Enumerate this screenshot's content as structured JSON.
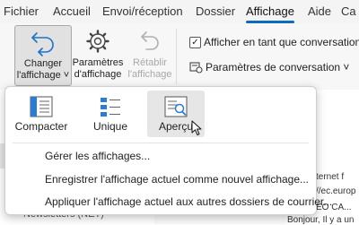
{
  "menubar": {
    "items": [
      {
        "label": "Fichier"
      },
      {
        "label": "Accueil"
      },
      {
        "label": "Envoi/réception"
      },
      {
        "label": "Dossier"
      },
      {
        "label": "Affichage",
        "active": true
      },
      {
        "label": "Aide"
      },
      {
        "label": "Ca"
      }
    ]
  },
  "ribbon": {
    "change_view": {
      "label": "Changer\nl'affichage ˅",
      "icon": "change-view-icon"
    },
    "view_settings": {
      "label": "Paramètres\nd'affichage",
      "icon": "gear-icon"
    },
    "reset_view": {
      "label": "Rétablir\nl'affichage",
      "icon": "reset-arrow-icon",
      "disabled": true
    },
    "show_as_conversations": {
      "label": "Afficher en tant que conversations",
      "checked": true
    },
    "conversation_settings": {
      "label": "Paramètres de conversation ˅",
      "icon": "conversation-settings-icon"
    }
  },
  "dropdown": {
    "views": [
      {
        "label": "Compacter",
        "icon": "compact-view-icon"
      },
      {
        "label": "Unique",
        "icon": "single-view-icon"
      },
      {
        "label": "Aperçu",
        "icon": "preview-view-icon",
        "hover": true
      }
    ],
    "commands": [
      {
        "label": "Gérer les affichages..."
      },
      {
        "label": "Enregistrer l'affichage actuel comme nouvel affichage..."
      },
      {
        "label": "Appliquer l'affichage actuel aux autres dossiers de courrier..."
      }
    ]
  },
  "background": {
    "right_texts": [
      "ternet f",
      "//ec.europ",
      "EO CA...",
      "Bonjour,  Il y a un"
    ],
    "left_folder": "Newsletters (NET)"
  },
  "colors": {
    "accent": "#0f6cbd"
  }
}
